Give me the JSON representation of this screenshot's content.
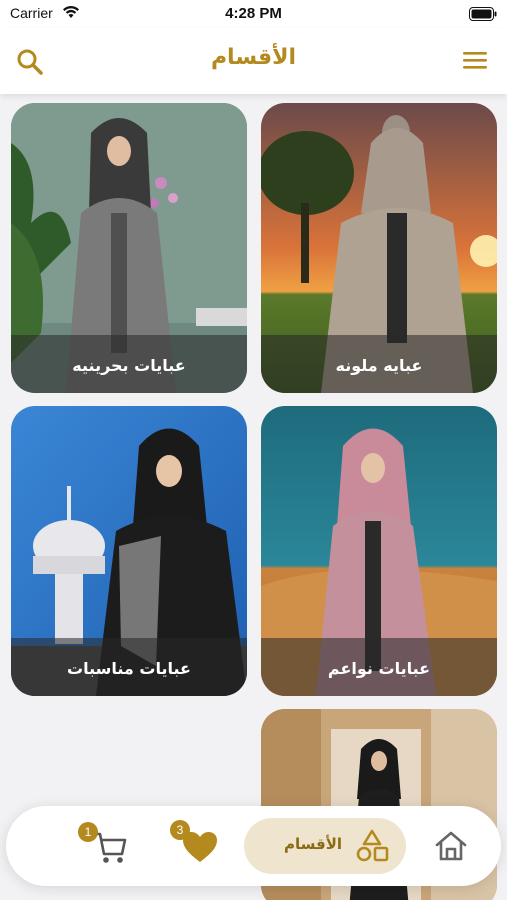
{
  "status_bar": {
    "carrier": "Carrier",
    "time": "4:28 PM"
  },
  "header": {
    "title": "الأقسام",
    "search_icon": "search-icon",
    "menu_icon": "hamburger-menu-icon"
  },
  "categories": [
    {
      "label": "عبايه ملونه"
    },
    {
      "label": "عبايات بحرينيه"
    },
    {
      "label": "عبايات نواعم"
    },
    {
      "label": "عبايات مناسبات"
    },
    {
      "label": ""
    }
  ],
  "tab_bar": {
    "home_icon": "home-icon",
    "categories_label": "الأقسام",
    "categories_icon": "shapes-icon",
    "favorites_count": "3",
    "favorites_icon": "heart-icon",
    "cart_count": "1",
    "cart_icon": "cart-icon"
  },
  "colors": {
    "accent": "#b48a1e",
    "active_tab_bg": "#efe5cf",
    "background": "#f2f2f4"
  }
}
